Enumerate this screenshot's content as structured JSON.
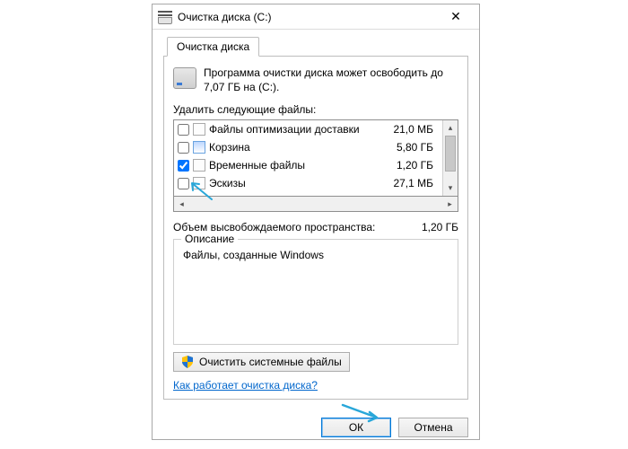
{
  "window": {
    "title": "Очистка диска (C:)"
  },
  "tab_label": "Очистка диска",
  "intro_text": "Программа очистки диска может освободить до 7,07 ГБ на (C:).",
  "list_label": "Удалить следующие файлы:",
  "files": [
    {
      "checked": false,
      "icon": "file",
      "name": "Файлы оптимизации доставки",
      "size": "21,0 МБ"
    },
    {
      "checked": false,
      "icon": "bin",
      "name": "Корзина",
      "size": "5,80 ГБ"
    },
    {
      "checked": true,
      "icon": "file",
      "name": "Временные файлы",
      "size": "1,20 ГБ"
    },
    {
      "checked": false,
      "icon": "file",
      "name": "Эскизы",
      "size": "27,1 МБ"
    }
  ],
  "total_label": "Объем высвобождаемого пространства:",
  "total_value": "1,20 ГБ",
  "group_title": "Описание",
  "description_text": "Файлы, созданные Windows",
  "sys_button": "Очистить системные файлы",
  "help_link": "Как работает очистка диска?",
  "buttons": {
    "ok": "ОК",
    "cancel": "Отмена"
  }
}
